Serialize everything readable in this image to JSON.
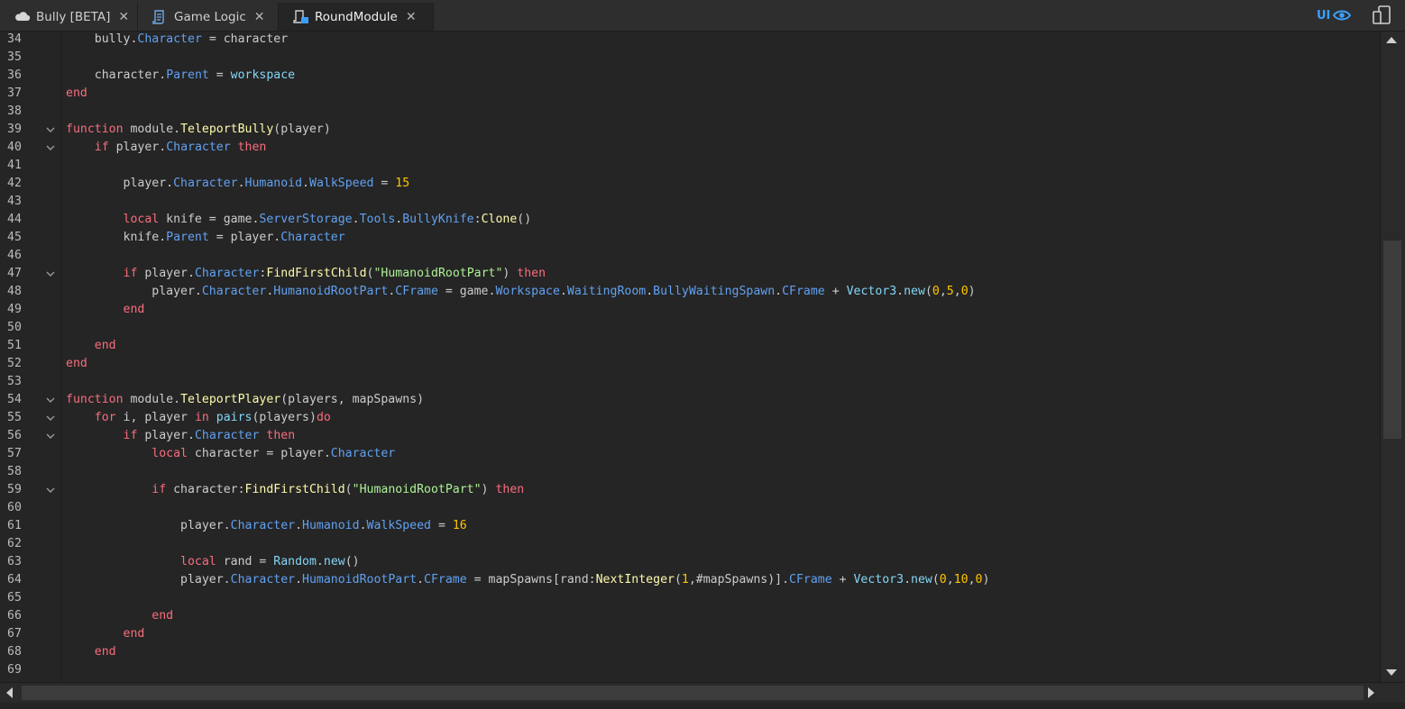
{
  "tabs": [
    {
      "label": "Bully [BETA]",
      "icon": "cloud-icon",
      "active": false
    },
    {
      "label": "Game Logic",
      "icon": "script-icon",
      "active": false
    },
    {
      "label": "RoundModule",
      "icon": "module-script-icon",
      "active": true
    }
  ],
  "toolbar": {
    "ui_label": "UI",
    "ui_icon": "eye-icon",
    "device_icon": "device-emulator-icon"
  },
  "colors": {
    "keyword": "#f86d7c",
    "property": "#61a1f1",
    "method": "#fdfbac",
    "number": "#ffc600",
    "string": "#adf195",
    "builtin": "#84d6f7",
    "identifier": "#cccccc",
    "editor_bg": "#252525",
    "accent": "#3aa0ff"
  },
  "code_lines": [
    {
      "n": "34",
      "fold": false,
      "tokens": [
        [
          "    ",
          "id"
        ],
        [
          "bully",
          "id"
        ],
        [
          ".",
          "id"
        ],
        [
          "Character",
          "prop"
        ],
        [
          " = character",
          "id"
        ]
      ]
    },
    {
      "n": "35",
      "fold": false,
      "tokens": []
    },
    {
      "n": "36",
      "fold": false,
      "tokens": [
        [
          "    ",
          "id"
        ],
        [
          "character",
          "id"
        ],
        [
          ".",
          "id"
        ],
        [
          "Parent",
          "prop"
        ],
        [
          " = ",
          "id"
        ],
        [
          "workspace",
          "bi"
        ]
      ]
    },
    {
      "n": "37",
      "fold": false,
      "tokens": [
        [
          "end",
          "kw"
        ]
      ]
    },
    {
      "n": "38",
      "fold": false,
      "tokens": []
    },
    {
      "n": "39",
      "fold": true,
      "tokens": [
        [
          "function",
          "kw"
        ],
        [
          " module.",
          "id"
        ],
        [
          "TeleportBully",
          "meth"
        ],
        [
          "(player)",
          "id"
        ]
      ]
    },
    {
      "n": "40",
      "fold": true,
      "tokens": [
        [
          "    ",
          "id"
        ],
        [
          "if",
          "kw"
        ],
        [
          " player.",
          "id"
        ],
        [
          "Character",
          "prop"
        ],
        [
          " ",
          "id"
        ],
        [
          "then",
          "kw"
        ]
      ]
    },
    {
      "n": "41",
      "fold": false,
      "tokens": []
    },
    {
      "n": "42",
      "fold": false,
      "tokens": [
        [
          "        player.",
          "id"
        ],
        [
          "Character",
          "prop"
        ],
        [
          ".",
          "id"
        ],
        [
          "Humanoid",
          "prop"
        ],
        [
          ".",
          "id"
        ],
        [
          "WalkSpeed",
          "prop"
        ],
        [
          " = ",
          "id"
        ],
        [
          "15",
          "num"
        ]
      ]
    },
    {
      "n": "43",
      "fold": false,
      "tokens": []
    },
    {
      "n": "44",
      "fold": false,
      "tokens": [
        [
          "        ",
          "id"
        ],
        [
          "local",
          "kw"
        ],
        [
          " knife = game.",
          "id"
        ],
        [
          "ServerStorage",
          "prop"
        ],
        [
          ".",
          "id"
        ],
        [
          "Tools",
          "prop"
        ],
        [
          ".",
          "id"
        ],
        [
          "BullyKnife",
          "prop"
        ],
        [
          ":",
          "id"
        ],
        [
          "Clone",
          "meth"
        ],
        [
          "()",
          "id"
        ]
      ]
    },
    {
      "n": "45",
      "fold": false,
      "tokens": [
        [
          "        knife.",
          "id"
        ],
        [
          "Parent",
          "prop"
        ],
        [
          " = player.",
          "id"
        ],
        [
          "Character",
          "prop"
        ]
      ]
    },
    {
      "n": "46",
      "fold": false,
      "tokens": []
    },
    {
      "n": "47",
      "fold": true,
      "tokens": [
        [
          "        ",
          "id"
        ],
        [
          "if",
          "kw"
        ],
        [
          " player.",
          "id"
        ],
        [
          "Character",
          "prop"
        ],
        [
          ":",
          "id"
        ],
        [
          "FindFirstChild",
          "meth"
        ],
        [
          "(",
          "id"
        ],
        [
          "\"HumanoidRootPart\"",
          "str"
        ],
        [
          ") ",
          "id"
        ],
        [
          "then",
          "kw"
        ]
      ]
    },
    {
      "n": "48",
      "fold": false,
      "tokens": [
        [
          "            player.",
          "id"
        ],
        [
          "Character",
          "prop"
        ],
        [
          ".",
          "id"
        ],
        [
          "HumanoidRootPart",
          "prop"
        ],
        [
          ".",
          "id"
        ],
        [
          "CFrame",
          "prop"
        ],
        [
          " = game.",
          "id"
        ],
        [
          "Workspace",
          "prop"
        ],
        [
          ".",
          "id"
        ],
        [
          "WaitingRoom",
          "prop"
        ],
        [
          ".",
          "id"
        ],
        [
          "BullyWaitingSpawn",
          "prop"
        ],
        [
          ".",
          "id"
        ],
        [
          "CFrame",
          "prop"
        ],
        [
          " + ",
          "id"
        ],
        [
          "Vector3",
          "bi"
        ],
        [
          ".",
          "id"
        ],
        [
          "new",
          "bi"
        ],
        [
          "(",
          "id"
        ],
        [
          "0",
          "num"
        ],
        [
          ",",
          "id"
        ],
        [
          "5",
          "num"
        ],
        [
          ",",
          "id"
        ],
        [
          "0",
          "num"
        ],
        [
          ")",
          "id"
        ]
      ]
    },
    {
      "n": "49",
      "fold": false,
      "tokens": [
        [
          "        ",
          "id"
        ],
        [
          "end",
          "kw"
        ]
      ]
    },
    {
      "n": "50",
      "fold": false,
      "tokens": []
    },
    {
      "n": "51",
      "fold": false,
      "tokens": [
        [
          "    ",
          "id"
        ],
        [
          "end",
          "kw"
        ]
      ]
    },
    {
      "n": "52",
      "fold": false,
      "tokens": [
        [
          "end",
          "kw"
        ]
      ]
    },
    {
      "n": "53",
      "fold": false,
      "tokens": []
    },
    {
      "n": "54",
      "fold": true,
      "tokens": [
        [
          "function",
          "kw"
        ],
        [
          " module.",
          "id"
        ],
        [
          "TeleportPlayer",
          "meth"
        ],
        [
          "(players, mapSpawns)",
          "id"
        ]
      ]
    },
    {
      "n": "55",
      "fold": true,
      "tokens": [
        [
          "    ",
          "id"
        ],
        [
          "for",
          "kw"
        ],
        [
          " i, player ",
          "id"
        ],
        [
          "in",
          "kw"
        ],
        [
          " ",
          "id"
        ],
        [
          "pairs",
          "bi"
        ],
        [
          "(players)",
          "id"
        ],
        [
          "do",
          "kw"
        ]
      ]
    },
    {
      "n": "56",
      "fold": true,
      "tokens": [
        [
          "        ",
          "id"
        ],
        [
          "if",
          "kw"
        ],
        [
          " player.",
          "id"
        ],
        [
          "Character",
          "prop"
        ],
        [
          " ",
          "id"
        ],
        [
          "then",
          "kw"
        ]
      ]
    },
    {
      "n": "57",
      "fold": false,
      "tokens": [
        [
          "            ",
          "id"
        ],
        [
          "local",
          "kw"
        ],
        [
          " character = player.",
          "id"
        ],
        [
          "Character",
          "prop"
        ]
      ]
    },
    {
      "n": "58",
      "fold": false,
      "tokens": []
    },
    {
      "n": "59",
      "fold": true,
      "tokens": [
        [
          "            ",
          "id"
        ],
        [
          "if",
          "kw"
        ],
        [
          " character:",
          "id"
        ],
        [
          "FindFirstChild",
          "meth"
        ],
        [
          "(",
          "id"
        ],
        [
          "\"HumanoidRootPart\"",
          "str"
        ],
        [
          ") ",
          "id"
        ],
        [
          "then",
          "kw"
        ]
      ]
    },
    {
      "n": "60",
      "fold": false,
      "tokens": []
    },
    {
      "n": "61",
      "fold": false,
      "tokens": [
        [
          "                player.",
          "id"
        ],
        [
          "Character",
          "prop"
        ],
        [
          ".",
          "id"
        ],
        [
          "Humanoid",
          "prop"
        ],
        [
          ".",
          "id"
        ],
        [
          "WalkSpeed",
          "prop"
        ],
        [
          " = ",
          "id"
        ],
        [
          "16",
          "num"
        ]
      ]
    },
    {
      "n": "62",
      "fold": false,
      "tokens": []
    },
    {
      "n": "63",
      "fold": false,
      "tokens": [
        [
          "                ",
          "id"
        ],
        [
          "local",
          "kw"
        ],
        [
          " rand = ",
          "id"
        ],
        [
          "Random",
          "bi"
        ],
        [
          ".",
          "id"
        ],
        [
          "new",
          "bi"
        ],
        [
          "()",
          "id"
        ]
      ]
    },
    {
      "n": "64",
      "fold": false,
      "tokens": [
        [
          "                player.",
          "id"
        ],
        [
          "Character",
          "prop"
        ],
        [
          ".",
          "id"
        ],
        [
          "HumanoidRootPart",
          "prop"
        ],
        [
          ".",
          "id"
        ],
        [
          "CFrame",
          "prop"
        ],
        [
          " = mapSpawns[rand:",
          "id"
        ],
        [
          "NextInteger",
          "meth"
        ],
        [
          "(",
          "id"
        ],
        [
          "1",
          "num"
        ],
        [
          ",#mapSpawns)].",
          "id"
        ],
        [
          "CFrame",
          "prop"
        ],
        [
          " + ",
          "id"
        ],
        [
          "Vector3",
          "bi"
        ],
        [
          ".",
          "id"
        ],
        [
          "new",
          "bi"
        ],
        [
          "(",
          "id"
        ],
        [
          "0",
          "num"
        ],
        [
          ",",
          "id"
        ],
        [
          "10",
          "num"
        ],
        [
          ",",
          "id"
        ],
        [
          "0",
          "num"
        ],
        [
          ")",
          "id"
        ]
      ]
    },
    {
      "n": "65",
      "fold": false,
      "tokens": []
    },
    {
      "n": "66",
      "fold": false,
      "tokens": [
        [
          "            ",
          "id"
        ],
        [
          "end",
          "kw"
        ]
      ]
    },
    {
      "n": "67",
      "fold": false,
      "tokens": [
        [
          "        ",
          "id"
        ],
        [
          "end",
          "kw"
        ]
      ]
    },
    {
      "n": "68",
      "fold": false,
      "tokens": [
        [
          "    ",
          "id"
        ],
        [
          "end",
          "kw"
        ]
      ]
    },
    {
      "n": "69",
      "fold": false,
      "tokens": []
    }
  ]
}
